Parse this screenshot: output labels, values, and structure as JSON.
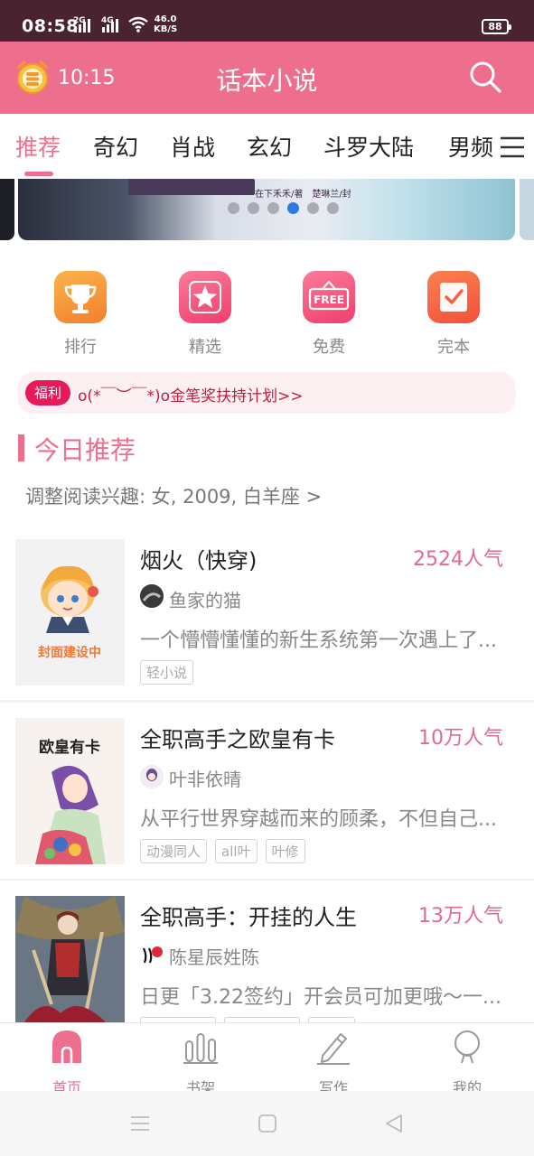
{
  "status_bar": {
    "time": "08:58",
    "signal1": "2G",
    "signal2": "4G",
    "speed_value": "46.0",
    "speed_unit": "KB/S",
    "battery": "88"
  },
  "header": {
    "time": "10:15",
    "title": "话本小说",
    "icons": [
      "alarm-coins-icon",
      "search-icon"
    ]
  },
  "tabs": [
    {
      "label": "推荐",
      "active": true
    },
    {
      "label": "奇幻"
    },
    {
      "label": "肖战"
    },
    {
      "label": "玄幻"
    },
    {
      "label": "斗罗大陆"
    },
    {
      "label": "男频"
    }
  ],
  "banner": {
    "caption": "在下禾禾/著　楚琳兰/封",
    "dot_count": 6,
    "active_dot": 3
  },
  "quick_actions": [
    {
      "label": "排行",
      "icon": "trophy-icon",
      "color": "#f7913a"
    },
    {
      "label": "精选",
      "icon": "star-icon",
      "color": "#f25479"
    },
    {
      "label": "免费",
      "icon": "free-tag-icon",
      "color": "#f25479"
    },
    {
      "label": "完本",
      "icon": "check-box-icon",
      "color": "#f46340"
    }
  ],
  "notice": {
    "badge": "福利",
    "text": "o(*￣︶￣*)o金笔奖扶持计划>>"
  },
  "section": {
    "title": "今日推荐",
    "subtitle": "调整阅读兴趣: 女, 2009, 白羊座 >"
  },
  "books": [
    {
      "title": "烟火（快穿)",
      "popularity": "2524人气",
      "author": "鱼家的猫",
      "description": "一个懵懵懂懂的新生系统第一次遇上了...",
      "tags": [
        "轻小说"
      ],
      "cover_text": "封面建设中"
    },
    {
      "title": "全职高手之欧皇有卡",
      "popularity": "10万人气",
      "author": "叶非依晴",
      "description": "从平行世界穿越而来的顾柔，不但自己...",
      "tags": [
        "动漫同人",
        "all叶",
        "叶修"
      ],
      "cover_text": "欧皇有卡"
    },
    {
      "title": "全职高手：开挂的人生",
      "popularity": "13万人气",
      "author": "陈星辰姓陈",
      "description": "日更「3.22签约」开会员可加更哦～一...",
      "tags": [
        "",
        "",
        ""
      ]
    }
  ],
  "bottom_nav": [
    {
      "label": "首页",
      "icon": "home-icon",
      "active": true
    },
    {
      "label": "书架",
      "icon": "bookshelf-icon"
    },
    {
      "label": "写作",
      "icon": "pen-icon"
    },
    {
      "label": "我的",
      "icon": "profile-icon"
    }
  ],
  "colors": {
    "accent": "#ee6e8e",
    "status_bar": "#4a2330",
    "popularity": "#e16a95"
  }
}
